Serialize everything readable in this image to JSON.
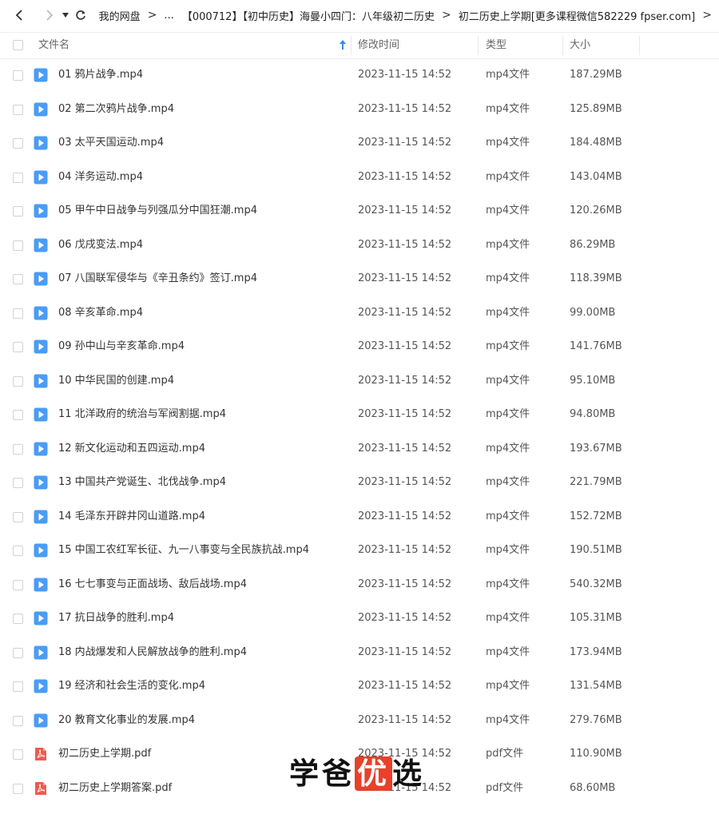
{
  "breadcrumb": {
    "items": [
      "我的网盘",
      "...",
      "【000712】【初中历史】海曼小四门：八年级初二历史",
      "初二历史上学期[更多课程微信582229 fpser.com]"
    ]
  },
  "columns": {
    "name": "文件名",
    "modified": "修改时间",
    "type": "类型",
    "size": "大小"
  },
  "colors": {
    "mp4_icon": "#4a9cf5",
    "pdf_icon": "#ef5b50",
    "watermark_highlight": "#e8402a"
  },
  "files": [
    {
      "name": "01 鸦片战争.mp4",
      "date": "2023-11-15 14:52",
      "type": "mp4文件",
      "size": "187.29MB",
      "icon": "video-file-icon"
    },
    {
      "name": "02 第二次鸦片战争.mp4",
      "date": "2023-11-15 14:52",
      "type": "mp4文件",
      "size": "125.89MB",
      "icon": "video-file-icon"
    },
    {
      "name": "03 太平天国运动.mp4",
      "date": "2023-11-15 14:52",
      "type": "mp4文件",
      "size": "184.48MB",
      "icon": "video-file-icon"
    },
    {
      "name": "04 洋务运动.mp4",
      "date": "2023-11-15 14:52",
      "type": "mp4文件",
      "size": "143.04MB",
      "icon": "video-file-icon"
    },
    {
      "name": "05 甲午中日战争与列强瓜分中国狂潮.mp4",
      "date": "2023-11-15 14:52",
      "type": "mp4文件",
      "size": "120.26MB",
      "icon": "video-file-icon"
    },
    {
      "name": "06 戊戌变法.mp4",
      "date": "2023-11-15 14:52",
      "type": "mp4文件",
      "size": "86.29MB",
      "icon": "video-file-icon"
    },
    {
      "name": "07 八国联军侵华与《辛丑条约》签订.mp4",
      "date": "2023-11-15 14:52",
      "type": "mp4文件",
      "size": "118.39MB",
      "icon": "video-file-icon"
    },
    {
      "name": "08 辛亥革命.mp4",
      "date": "2023-11-15 14:52",
      "type": "mp4文件",
      "size": "99.00MB",
      "icon": "video-file-icon"
    },
    {
      "name": "09 孙中山与辛亥革命.mp4",
      "date": "2023-11-15 14:52",
      "type": "mp4文件",
      "size": "141.76MB",
      "icon": "video-file-icon"
    },
    {
      "name": "10 中华民国的创建.mp4",
      "date": "2023-11-15 14:52",
      "type": "mp4文件",
      "size": "95.10MB",
      "icon": "video-file-icon"
    },
    {
      "name": "11 北洋政府的统治与军阀割据.mp4",
      "date": "2023-11-15 14:52",
      "type": "mp4文件",
      "size": "94.80MB",
      "icon": "video-file-icon"
    },
    {
      "name": "12 新文化运动和五四运动.mp4",
      "date": "2023-11-15 14:52",
      "type": "mp4文件",
      "size": "193.67MB",
      "icon": "video-file-icon"
    },
    {
      "name": "13 中国共产党诞生、北伐战争.mp4",
      "date": "2023-11-15 14:52",
      "type": "mp4文件",
      "size": "221.79MB",
      "icon": "video-file-icon"
    },
    {
      "name": "14 毛泽东开辟井冈山道路.mp4",
      "date": "2023-11-15 14:52",
      "type": "mp4文件",
      "size": "152.72MB",
      "icon": "video-file-icon"
    },
    {
      "name": "15 中国工农红军长征、九一八事变与全民族抗战.mp4",
      "date": "2023-11-15 14:52",
      "type": "mp4文件",
      "size": "190.51MB",
      "icon": "video-file-icon"
    },
    {
      "name": "16 七七事变与正面战场、敌后战场.mp4",
      "date": "2023-11-15 14:52",
      "type": "mp4文件",
      "size": "540.32MB",
      "icon": "video-file-icon"
    },
    {
      "name": "17 抗日战争的胜利.mp4",
      "date": "2023-11-15 14:52",
      "type": "mp4文件",
      "size": "105.31MB",
      "icon": "video-file-icon"
    },
    {
      "name": "18 内战爆发和人民解放战争的胜利.mp4",
      "date": "2023-11-15 14:52",
      "type": "mp4文件",
      "size": "173.94MB",
      "icon": "video-file-icon"
    },
    {
      "name": "19 经济和社会生活的变化.mp4",
      "date": "2023-11-15 14:52",
      "type": "mp4文件",
      "size": "131.54MB",
      "icon": "video-file-icon"
    },
    {
      "name": "20 教育文化事业的发展.mp4",
      "date": "2023-11-15 14:52",
      "type": "mp4文件",
      "size": "279.76MB",
      "icon": "video-file-icon"
    },
    {
      "name": "初二历史上学期.pdf",
      "date": "2023-11-15 14:52",
      "type": "pdf文件",
      "size": "110.90MB",
      "icon": "pdf-file-icon"
    },
    {
      "name": "初二历史上学期答案.pdf",
      "date": "2023-11-15 14:52",
      "type": "pdf文件",
      "size": "68.60MB",
      "icon": "pdf-file-icon"
    }
  ],
  "watermark": {
    "text_before": "学爸",
    "text_highlight": "优",
    "text_after": "选"
  }
}
